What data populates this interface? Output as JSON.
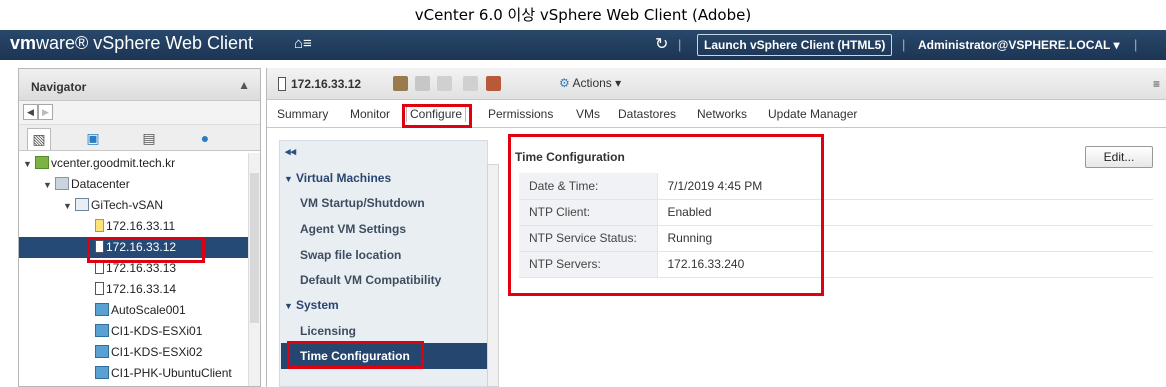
{
  "caption": "vCenter 6.0 이상 vSphere Web Client (Adobe)",
  "topbar": {
    "brand_prefix": "vm",
    "brand_rest": "ware",
    "product": "vSphere Web Client",
    "launch_label": "Launch vSphere Client (HTML5)",
    "user_label": "Administrator@VSPHERE.LOCAL ▾"
  },
  "navigator": {
    "title": "Navigator",
    "tree": [
      {
        "label": "vcenter.goodmit.tech.kr",
        "icon": "vcenter-icon",
        "level": 0,
        "twisty": "expanded"
      },
      {
        "label": "Datacenter",
        "icon": "datacenter-icon",
        "level": 1,
        "twisty": "expanded"
      },
      {
        "label": "GiTech-vSAN",
        "icon": "cluster-icon",
        "level": 2,
        "twisty": "expanded"
      },
      {
        "label": "172.16.33.11",
        "icon": "host-warning-icon",
        "level": 3
      },
      {
        "label": "172.16.33.12",
        "icon": "host-icon",
        "level": 3,
        "selected": true
      },
      {
        "label": "172.16.33.13",
        "icon": "host-icon",
        "level": 3
      },
      {
        "label": "172.16.33.14",
        "icon": "host-icon",
        "level": 3
      },
      {
        "label": "AutoScale001",
        "icon": "vm-icon",
        "level": 3
      },
      {
        "label": "CI1-KDS-ESXi01",
        "icon": "vm-icon",
        "level": 3
      },
      {
        "label": "CI1-KDS-ESXi02",
        "icon": "vm-icon",
        "level": 3
      },
      {
        "label": "CI1-PHK-UbuntuClient",
        "icon": "vm-icon",
        "level": 3
      }
    ]
  },
  "object": {
    "name": "172.16.33.12",
    "actions_label": "Actions ▾"
  },
  "tabs": [
    {
      "label": "Summary",
      "active": false
    },
    {
      "label": "Monitor",
      "active": false
    },
    {
      "label": "Configure",
      "active": true
    },
    {
      "label": "Permissions",
      "active": false
    },
    {
      "label": "VMs",
      "active": false
    },
    {
      "label": "Datastores",
      "active": false
    },
    {
      "label": "Networks",
      "active": false
    },
    {
      "label": "Update Manager",
      "active": false
    }
  ],
  "configure_menu": {
    "collapse_glyph": "◂◂",
    "sections": [
      {
        "label": "Virtual Machines",
        "items": [
          "VM Startup/Shutdown",
          "Agent VM Settings",
          "Swap file location",
          "Default VM Compatibility"
        ]
      },
      {
        "label": "System",
        "items": [
          "Licensing",
          "Time Configuration"
        ]
      }
    ],
    "selected_item": "Time Configuration"
  },
  "time_config": {
    "title": "Time Configuration",
    "edit_label": "Edit...",
    "rows": [
      {
        "key": "Date & Time:",
        "value": "7/1/2019 4:45 PM"
      },
      {
        "key": "NTP Client:",
        "value": "Enabled"
      },
      {
        "key": "NTP Service Status:",
        "value": "Running"
      },
      {
        "key": "NTP Servers:",
        "value": "172.16.33.240"
      }
    ]
  },
  "colors": {
    "topbar": "#1f3a5c",
    "selection": "#24466f",
    "highlight_box": "#e00010"
  }
}
